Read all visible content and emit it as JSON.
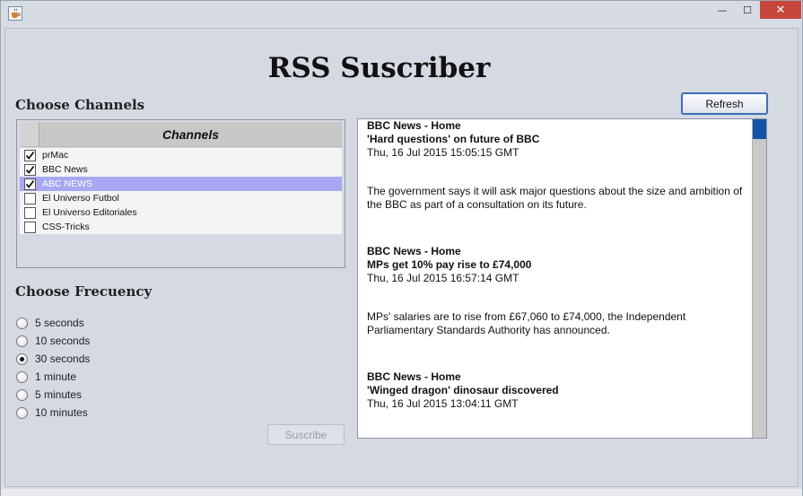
{
  "window": {
    "app_icon": "java-cup-icon",
    "controls": {
      "minimize": "—",
      "maximize": "☐",
      "close": "✕"
    }
  },
  "app": {
    "title": "RSS Suscriber"
  },
  "channels": {
    "section_label": "Choose Channels",
    "column_header": "Channels",
    "items": [
      {
        "name": "prMac",
        "checked": true,
        "selected": false
      },
      {
        "name": "BBC News",
        "checked": true,
        "selected": false
      },
      {
        "name": "ABC NEWS",
        "checked": true,
        "selected": true
      },
      {
        "name": "El Universo Futbol",
        "checked": false,
        "selected": false
      },
      {
        "name": "El Universo Editoriales",
        "checked": false,
        "selected": false
      },
      {
        "name": "CSS-Tricks",
        "checked": false,
        "selected": false
      }
    ]
  },
  "frequency": {
    "section_label": "Choose Frecuency",
    "options": [
      {
        "label": "5 seconds",
        "checked": false
      },
      {
        "label": "10 seconds",
        "checked": false
      },
      {
        "label": "30 seconds",
        "checked": true
      },
      {
        "label": "1 minute",
        "checked": false
      },
      {
        "label": "5 minutes",
        "checked": false
      },
      {
        "label": "10 minutes",
        "checked": false
      }
    ]
  },
  "buttons": {
    "refresh": "Refresh",
    "suscribe": "Suscribe"
  },
  "news": {
    "items": [
      {
        "source": "BBC News - Home",
        "title": "'Hard questions' on future of BBC",
        "date": "Thu, 16 Jul 2015 15:05:15 GMT",
        "description": "The government says it will ask major questions about the size and ambition of the BBC as part of a consultation on its future."
      },
      {
        "source": "BBC News - Home",
        "title": "MPs get 10% pay rise to £74,000",
        "date": "Thu, 16 Jul 2015 16:57:14 GMT",
        "description": "MPs' salaries are to rise from £67,060 to £74,000, the Independent Parliamentary Standards Authority has announced."
      },
      {
        "source": "BBC News - Home",
        "title": "'Winged dragon' dinosaur discovered",
        "date": "Thu, 16 Jul 2015 13:04:11 GMT",
        "description": ""
      }
    ]
  },
  "colors": {
    "window_bg": "#d7dbe3",
    "selection": "#a7a8f2",
    "close_button": "#c7463c",
    "scroll_thumb": "#1454a6",
    "focus_border": "#3d6fb5"
  }
}
